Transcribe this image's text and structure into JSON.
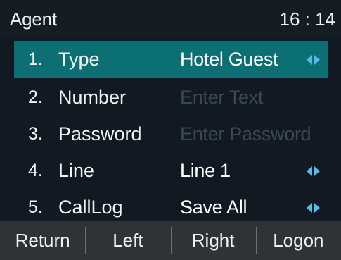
{
  "header": {
    "title": "Agent",
    "time": "16 : 14"
  },
  "menu": {
    "items": [
      {
        "index": "1.",
        "label": "Type",
        "value": "Hotel Guest",
        "placeholder": "",
        "selected": true,
        "has_arrows": true
      },
      {
        "index": "2.",
        "label": "Number",
        "value": "",
        "placeholder": "Enter Text",
        "selected": false,
        "has_arrows": false
      },
      {
        "index": "3.",
        "label": "Password",
        "value": "",
        "placeholder": "Enter Password",
        "selected": false,
        "has_arrows": false
      },
      {
        "index": "4.",
        "label": "Line",
        "value": "Line 1",
        "placeholder": "",
        "selected": false,
        "has_arrows": true
      },
      {
        "index": "5.",
        "label": "CallLog",
        "value": "Save All",
        "placeholder": "",
        "selected": false,
        "has_arrows": true
      }
    ]
  },
  "softkeys": [
    "Return",
    "Left",
    "Right",
    "Logon"
  ],
  "colors": {
    "selected_row": "#0b6f73",
    "arrow": "#58b8e8",
    "softkey_bar": "#2e3338",
    "background": "#111923"
  },
  "icons": {
    "left_arrow": "left-triangle-icon",
    "right_arrow": "right-triangle-icon"
  }
}
